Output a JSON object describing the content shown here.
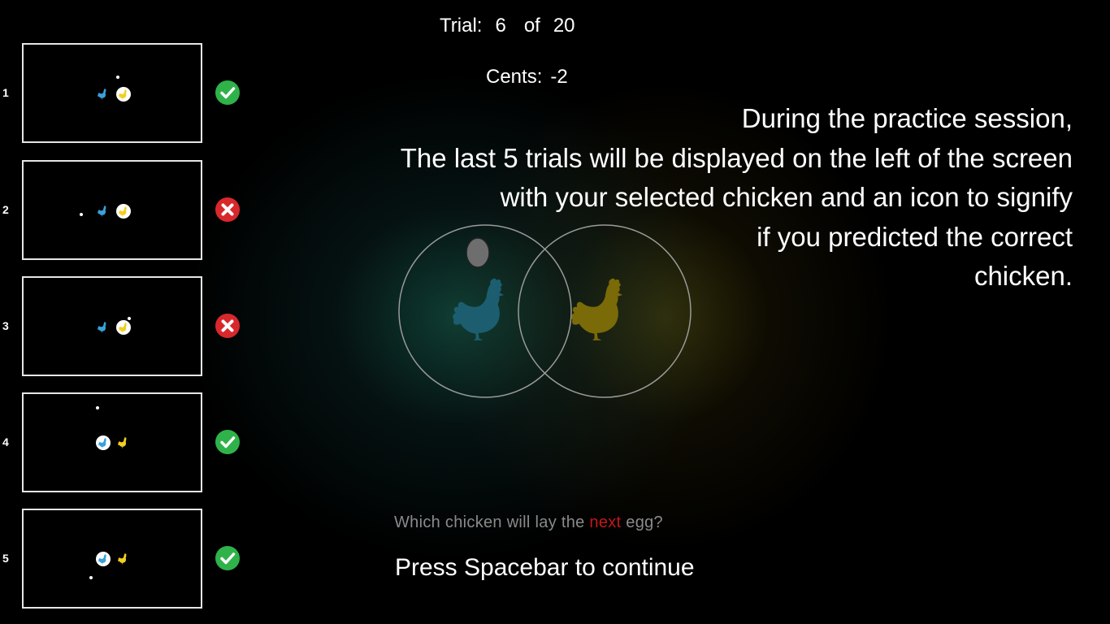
{
  "header": {
    "trial_label": "Trial:",
    "trial_number": "6",
    "of_label": "of",
    "trial_total": "20",
    "cents_label": "Cents:",
    "cents_value": "-2"
  },
  "instructions": [
    "During the practice session,",
    "The last 5 trials will be displayed on the left of the screen",
    "with your selected chicken and an icon to signify",
    "if you predicted the correct",
    "chicken."
  ],
  "prompt": {
    "before": "Which chicken will lay the ",
    "highlight": "next",
    "after": " egg?"
  },
  "continue_text": "Press Spacebar to continue",
  "colors": {
    "blue_chicken": "#1c5e70",
    "yellow_chicken": "#7a6a08",
    "correct": "#2fb24a",
    "incorrect": "#d8282c",
    "highlight": "#c21818"
  },
  "history": [
    {
      "number": "1",
      "result": "correct",
      "result_icon": "checkmark-icon",
      "selected": "yellow"
    },
    {
      "number": "2",
      "result": "incorrect",
      "result_icon": "cross-icon",
      "selected": "yellow"
    },
    {
      "number": "3",
      "result": "incorrect",
      "result_icon": "cross-icon",
      "selected": "yellow"
    },
    {
      "number": "4",
      "result": "correct",
      "result_icon": "checkmark-icon",
      "selected": "blue"
    },
    {
      "number": "5",
      "result": "correct",
      "result_icon": "checkmark-icon",
      "selected": "blue"
    }
  ]
}
